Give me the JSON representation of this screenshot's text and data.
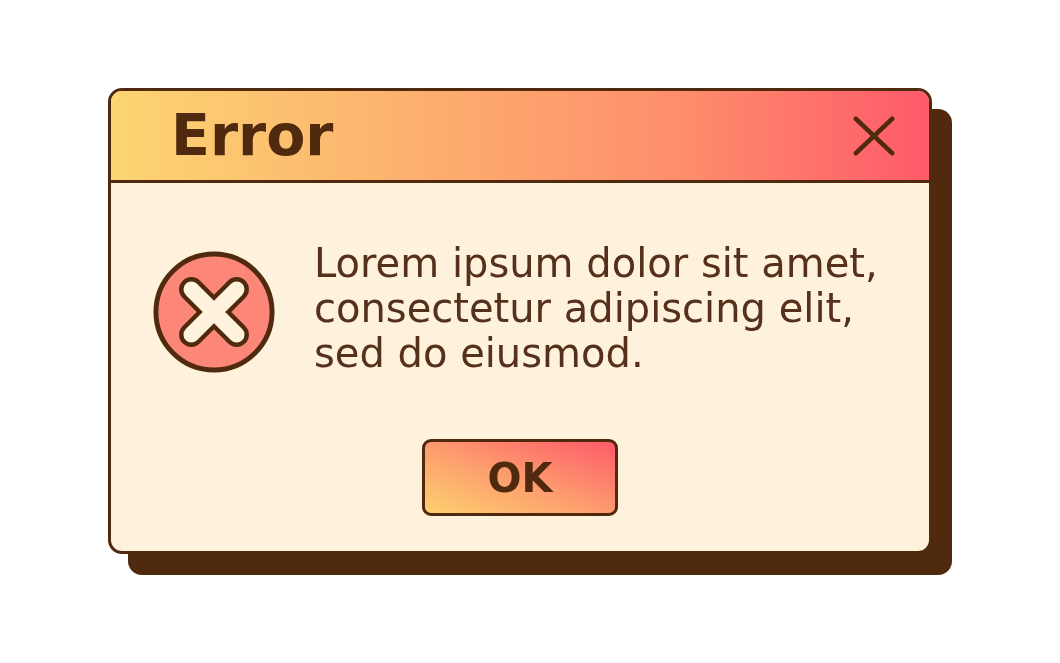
{
  "window": {
    "title": "Error"
  },
  "message": "Lorem ipsum dolor sit amet, consectetur adipiscing elit, sed do eiusmod.",
  "buttons": [
    {
      "label": "OK"
    }
  ]
}
